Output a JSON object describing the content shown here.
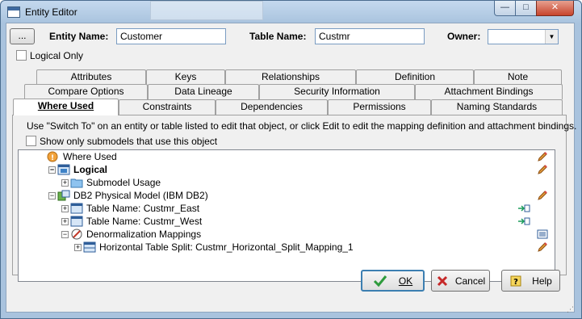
{
  "window": {
    "title": "Entity Editor",
    "controls": {
      "minimize": "—",
      "maximize": "□",
      "close": "✕"
    }
  },
  "header": {
    "browse_button": "...",
    "entity_name_label": "Entity Name:",
    "entity_name_value": "Customer",
    "table_name_label": "Table Name:",
    "table_name_value": "Custmr",
    "owner_label": "Owner:",
    "owner_value": "",
    "logical_only_label": "Logical Only",
    "logical_only_checked": false
  },
  "tabs": {
    "row1": [
      "Attributes",
      "Keys",
      "Relationships",
      "Definition",
      "Note"
    ],
    "row2": [
      "Compare Options",
      "Data Lineage",
      "Security Information",
      "Attachment Bindings"
    ],
    "row3": [
      "Where Used",
      "Constraints",
      "Dependencies",
      "Permissions",
      "Naming Standards"
    ],
    "active": "Where Used"
  },
  "where_used": {
    "instructions": "Use \"Switch To\" on an entity or table listed to edit that object, or click Edit to edit the mapping definition and attachment bindings.",
    "submodels_checkbox_label": "Show only submodels that use this object",
    "submodels_checked": false,
    "tree": [
      {
        "label": "Where Used",
        "icon": "where-used-icon"
      },
      {
        "label": "Logical",
        "icon": "logical-model-icon"
      },
      {
        "label": "Submodel Usage",
        "icon": "folder-icon"
      },
      {
        "label": "DB2 Physical Model (IBM DB2)",
        "icon": "physical-model-icon"
      },
      {
        "label": "Table Name: Custmr_East",
        "icon": "table-icon"
      },
      {
        "label": "Table Name: Custmr_West",
        "icon": "table-icon"
      },
      {
        "label": "Denormalization Mappings",
        "icon": "denormalization-icon"
      },
      {
        "label": "Horizontal Table Split: Custmr_Horizontal_Split_Mapping_1",
        "icon": "table-split-icon"
      }
    ]
  },
  "footer": {
    "ok": "OK",
    "cancel": "Cancel",
    "help": "Help"
  },
  "colors": {
    "accent": "#3c7fb1",
    "pencil": "#d9822b",
    "switch_to": "#1a9c5a"
  }
}
